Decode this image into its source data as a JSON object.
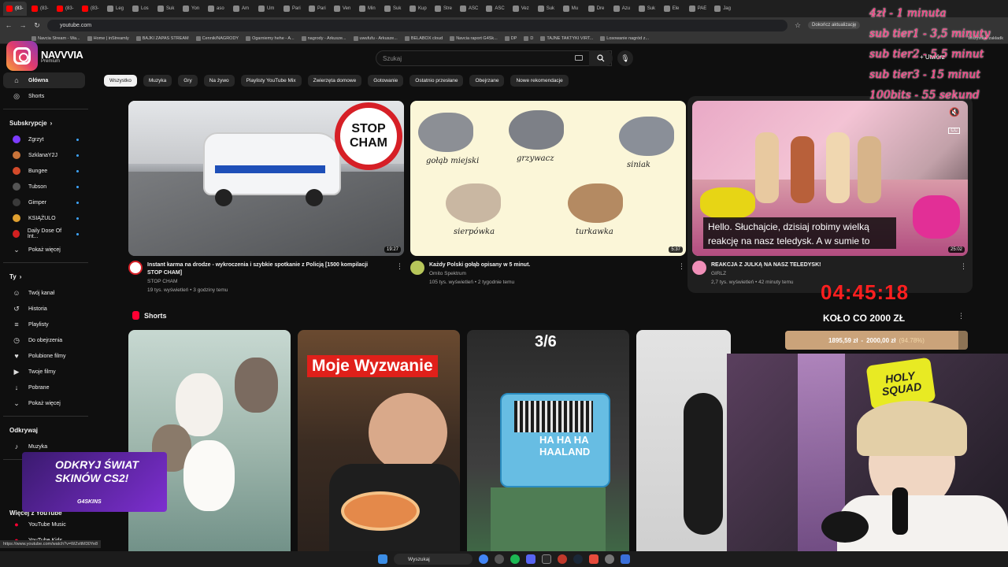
{
  "browser": {
    "tabs": [
      "(83-",
      "(83-",
      "(83-",
      "(83-",
      "Leg",
      "Los",
      "Suk",
      "Yon",
      "aso",
      "Am",
      "Um",
      "Pari",
      "Pari",
      "Ven",
      "Min",
      "Suk",
      "Kup",
      "Stre",
      "ASC",
      "ASC",
      "Vez",
      "Suk",
      "Mu",
      "Dre",
      "Azu",
      "Suk",
      "Ele",
      "PAE",
      "Jag"
    ],
    "url": "youtube.com",
    "update_label": "Dokończ aktualizację",
    "bookmarks": [
      "Navcia Stream - Wa...",
      "Home | inStreamly",
      "BAJKI ZAPAS STREAM",
      "Cennik/NAGRODY",
      "Ogarniemy hehe - A...",
      "nagrody - Arkusze...",
      "uwufufu - Arkusze...",
      "BELABOX cloud",
      "Navcia raport G4Sk...",
      "DP",
      "D",
      "TAJNE TAKTYKI VIRT...",
      "Losowanie nagród z..."
    ],
    "bookmarks_all": "Wszystkie zakładk"
  },
  "youtube": {
    "logo": "NAVVVIA",
    "logo_sub": "Premium",
    "search_placeholder": "Szukaj",
    "create_label": "Utwórz"
  },
  "sidebar": {
    "main": [
      {
        "label": "Główna",
        "icon": "home-icon",
        "glyph": "⌂",
        "active": true
      },
      {
        "label": "Shorts",
        "icon": "shorts-icon",
        "glyph": "◎",
        "active": false
      }
    ],
    "subs_heading": "Subskrypcje",
    "subs": [
      {
        "label": "Zgrzyt",
        "color": "#7d3cff",
        "dot": true
      },
      {
        "label": "SzklanaY2J",
        "color": "#c9743a",
        "dot": true
      },
      {
        "label": "Bungee",
        "color": "#d34a2a",
        "dot": true
      },
      {
        "label": "Tubson",
        "color": "#555555",
        "dot": true
      },
      {
        "label": "Gimper",
        "color": "#3a3a3a",
        "dot": true
      },
      {
        "label": "KSIĄŻULO",
        "color": "#e0a030",
        "dot": true
      },
      {
        "label": "Daily Dose Of Int...",
        "color": "#d32020",
        "dot": true
      }
    ],
    "subs_more": "Pokaż więcej",
    "you_heading": "Ty",
    "you": [
      {
        "label": "Twój kanał",
        "glyph": "☺"
      },
      {
        "label": "Historia",
        "glyph": "↺"
      },
      {
        "label": "Playlisty",
        "glyph": "≡"
      },
      {
        "label": "Do obejrzenia",
        "glyph": "◷"
      },
      {
        "label": "Polubione filmy",
        "glyph": "♥"
      },
      {
        "label": "Twoje filmy",
        "glyph": "▶"
      },
      {
        "label": "Pobrane",
        "glyph": "↓"
      }
    ],
    "you_more": "Pokaż więcej",
    "explore_heading": "Odkrywaj",
    "explore": [
      {
        "label": "Muzyka",
        "glyph": "♪"
      }
    ],
    "more_heading": "Więcej z YouTube",
    "more": [
      {
        "label": "YouTube Music",
        "glyph": "●"
      },
      {
        "label": "YouTube Kids",
        "glyph": "●"
      }
    ]
  },
  "chips": [
    "Wszystko",
    "Muzyka",
    "Gry",
    "Na żywo",
    "Playlisty YouTube Mix",
    "Zwierzęta domowe",
    "Gotowanie",
    "Ostatnio przesłane",
    "Obejrzane",
    "Nowe rekomendacje"
  ],
  "videos": [
    {
      "title_line1": "Instant karma na drodze - wykroczenia i szybkie spotkanie z Policją [1500 kompilacji",
      "title_line2": "STOP CHAM]",
      "channel": "STOP CHAM",
      "meta": "19 tys. wyświetleń • 3 godziny temu",
      "duration": "19:27",
      "thumb_text": "STOP CHAM"
    },
    {
      "title_line1": "Każdy Polski gołąb opisany w 5 minut.",
      "title_line2": "",
      "channel": "Omito Spektrum",
      "meta": "105 tys. wyświetleń • 2 tygodnie temu",
      "duration": "5:37",
      "pigeons": [
        "gołąb miejski",
        "grzywacz",
        "siniak",
        "sierpówka",
        "turkawka"
      ]
    },
    {
      "title_line1": "REAKCJA Z JULKĄ NA NASZ TELEDYSK!",
      "title_line2": "",
      "channel": "GIRLZ",
      "meta": "2,7 tys. wyświetleń • 42 minuty temu",
      "duration": "25:02",
      "caption": "Hello. Słuchajcie, dzisiaj robimy wielką reakcję na nasz teledysk. A w sumie to"
    }
  ],
  "shorts_heading": "Shorts",
  "shorts": [
    {
      "overlay": ""
    },
    {
      "overlay": "Moje Wyzwanie"
    },
    {
      "overlay": "3/6",
      "toy_text": "HA HA HA HAALAND"
    },
    {
      "overlay": ""
    }
  ],
  "stream": {
    "rates": [
      "4zł - 1 minuta",
      "sub tier1 - 3,5 minuty",
      "sub tier2 - 5,5 minut",
      "sub tier3 - 15 minut",
      "100bits - 55 sekund"
    ],
    "timer": "04:45:18",
    "goal_title": "KOŁO CO 2000 ZŁ",
    "goal_current": "1895,59 zł",
    "goal_sep": "-",
    "goal_target": "2000,00 zł",
    "goal_pct": "(94.78%)",
    "goal_fraction": 0.9478,
    "webcam_badge": "HOLY SQUAD",
    "promo_line1": "ODKRYJ ŚWIAT",
    "promo_line2": "SKINÓW CS2!",
    "promo_brand": "G4SKINS"
  },
  "status_url": "https://www.youtube.com/watch?v=WZvltM30Ye8",
  "taskbar": {
    "search": "Wyszukaj"
  }
}
